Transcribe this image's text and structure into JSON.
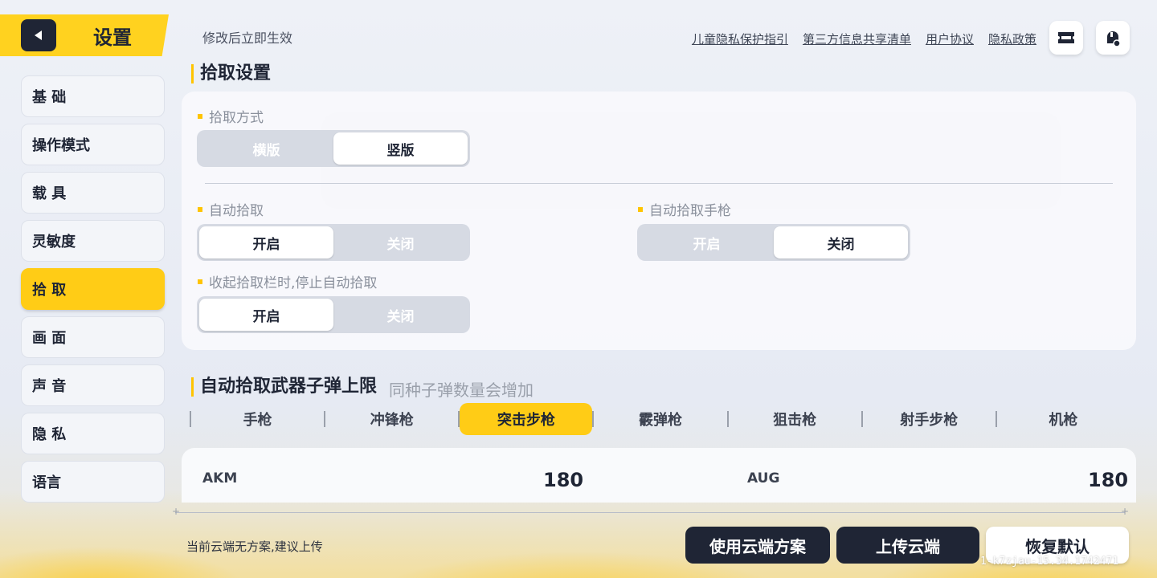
{
  "header": {
    "title": "设置",
    "hint": "修改后立即生效"
  },
  "top_links": [
    "儿童隐私保护指引",
    "第三方信息共享清单",
    "用户协议",
    "隐私政策"
  ],
  "icons": {
    "back": "back-arrow-icon",
    "ticket": "ticket-icon",
    "service": "customer-service-icon"
  },
  "sidebar": {
    "items": [
      {
        "label": "基 础"
      },
      {
        "label": "操作模式"
      },
      {
        "label": "载 具"
      },
      {
        "label": "灵敏度"
      },
      {
        "label": "拾 取"
      },
      {
        "label": "画 面"
      },
      {
        "label": "声 音"
      },
      {
        "label": "隐 私"
      },
      {
        "label": "语言"
      }
    ],
    "active": "拾 取"
  },
  "pickup": {
    "title": "拾取设置",
    "mode": {
      "label": "拾取方式",
      "options": [
        "横版",
        "竖版"
      ],
      "selected": "竖版"
    },
    "auto_pickup": {
      "label": "自动拾取",
      "options": [
        "开启",
        "关闭"
      ],
      "selected": "开启"
    },
    "auto_pickup_pistol": {
      "label": "自动拾取手枪",
      "options": [
        "开启",
        "关闭"
      ],
      "selected": "关闭"
    },
    "stop_when_collapsed": {
      "label": "收起拾取栏时,停止自动拾取",
      "options": [
        "开启",
        "关闭"
      ],
      "selected": "开启"
    }
  },
  "ammo": {
    "title": "自动拾取武器子弹上限",
    "subtitle": "同种子弹数量会增加",
    "tabs": [
      "手枪",
      "冲锋枪",
      "突击步枪",
      "霰弹枪",
      "狙击枪",
      "射手步枪",
      "机枪"
    ],
    "active_tab": "突击步枪",
    "weapons": [
      {
        "name": "AKM",
        "value": "180"
      },
      {
        "name": "AUG",
        "value": "180"
      }
    ]
  },
  "footer": {
    "cloud_hint": "当前云端无方案,建议上传",
    "use_cloud": "使用云端方案",
    "upload": "上传云端",
    "restore": "恢复默认",
    "version": "1-k7zjau-15.34.1742471"
  },
  "colors": {
    "accent": "#ffcc16",
    "dark": "#1f2535"
  }
}
